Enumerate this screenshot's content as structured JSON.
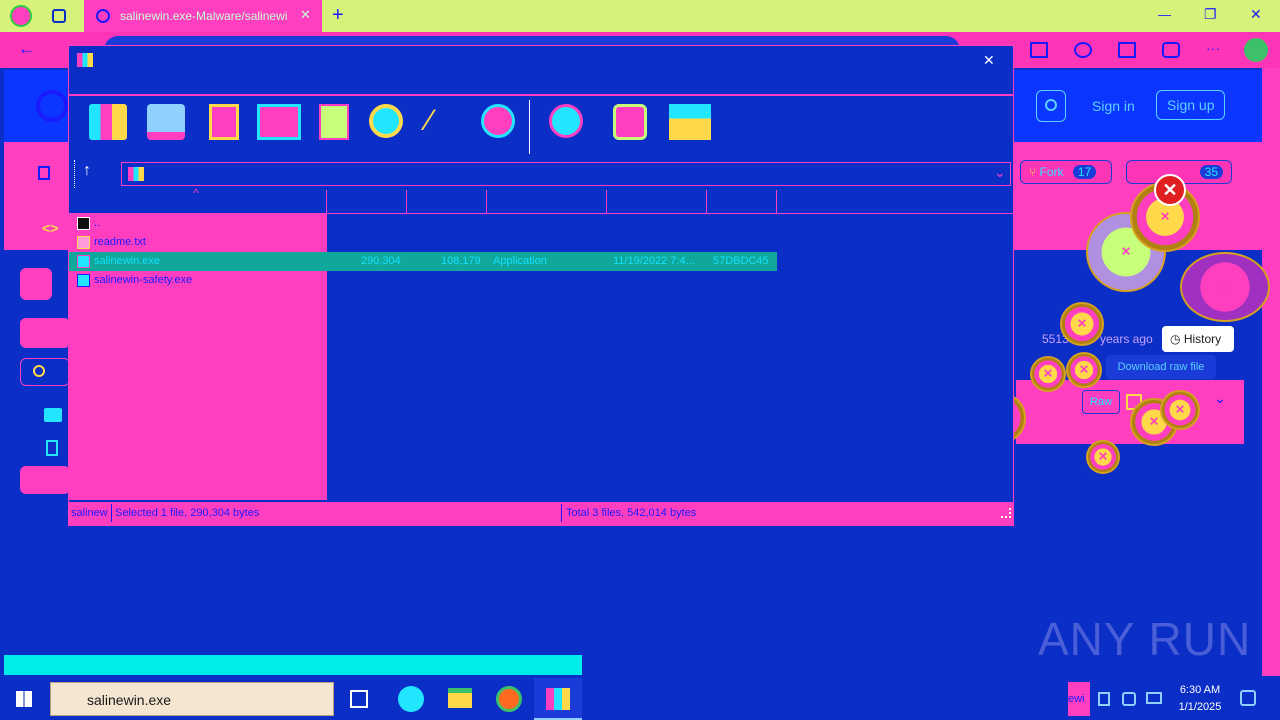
{
  "browser": {
    "tab_title": "salinewin.exe-Malware/salinewi",
    "new_tab": "+",
    "back": "←",
    "minimize": "—",
    "restore": "❐",
    "close": "✕",
    "more": "···"
  },
  "github": {
    "sign_in": "Sign in",
    "sign_up": "Sign up",
    "fork_label": "Fork",
    "fork_count": "17",
    "star_count": "35",
    "history_label": "History",
    "download_tooltip": "Download raw file",
    "raw_label": "Raw",
    "commit_info_partial": "5513",
    "commit_age": "years ago"
  },
  "winrar": {
    "close": "✕",
    "parent_dir": "..",
    "files": [
      {
        "name": "readme.txt",
        "size": "",
        "packed": "",
        "type": "",
        "modified": "",
        "crc": ""
      },
      {
        "name": "salinewin.exe",
        "size": "290,304",
        "packed": "108,179",
        "type": "Application",
        "modified": "11/19/2022 7:4...",
        "crc": "57DBDC45"
      },
      {
        "name": "salinewin-safety.exe",
        "size": "",
        "packed": "",
        "type": "",
        "modified": "",
        "crc": ""
      }
    ],
    "status_left_name": "salinew",
    "status_selected": "Selected 1 file, 290,304 bytes",
    "status_total": "Total 3 files, 542,014 bytes"
  },
  "taskbar": {
    "search_text": "salinewin.exe",
    "time": "6:30 AM",
    "date": "1/1/2025",
    "tray_label": "ewi"
  },
  "watermark": {
    "text": "ANY RUN"
  },
  "colors": {
    "accent_pink": "#ff3fc0",
    "background_blue": "#0a2ec6",
    "selection_teal": "#10a89a",
    "cyan": "#00ecea",
    "tabstrip_green": "#d7f27a"
  }
}
